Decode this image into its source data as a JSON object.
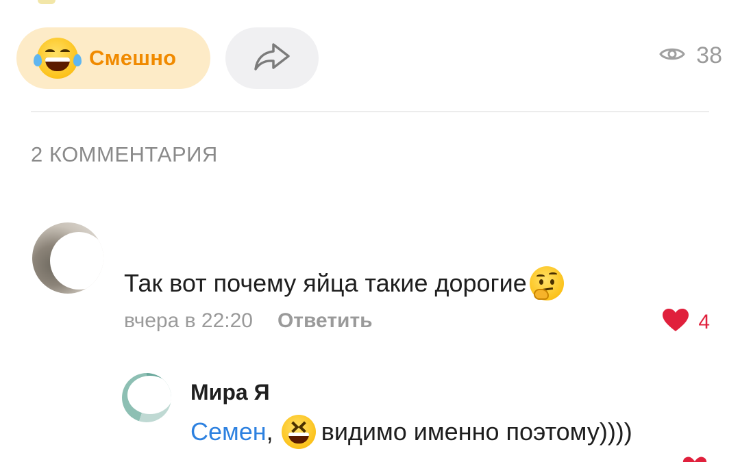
{
  "actions": {
    "reaction": {
      "label": "Смешно",
      "icon": "face-with-tears-of-joy-emoji"
    },
    "share": {
      "icon": "share-arrow-icon"
    },
    "views": {
      "icon": "eye-icon",
      "count": "38"
    }
  },
  "comments": {
    "header": "2 КОММЕНТАРИЯ",
    "items": [
      {
        "text": "Так вот почему яйца такие дорогие",
        "emoji": "thinking-face-emoji",
        "time": "вчера в 22:20",
        "reply_label": "Ответить",
        "likes": "4"
      }
    ],
    "reply": {
      "author": "Мира Я",
      "mention": "Семен",
      "comma": ",",
      "emoji": "grinning-squinting-face-emoji",
      "text": "видимо именно поэтому))))"
    }
  },
  "colors": {
    "reaction_bg": "#fdebc7",
    "reaction_text": "#f08a00",
    "like": "#e0203c",
    "mention": "#2d81e0",
    "muted": "#9a9a9a"
  }
}
